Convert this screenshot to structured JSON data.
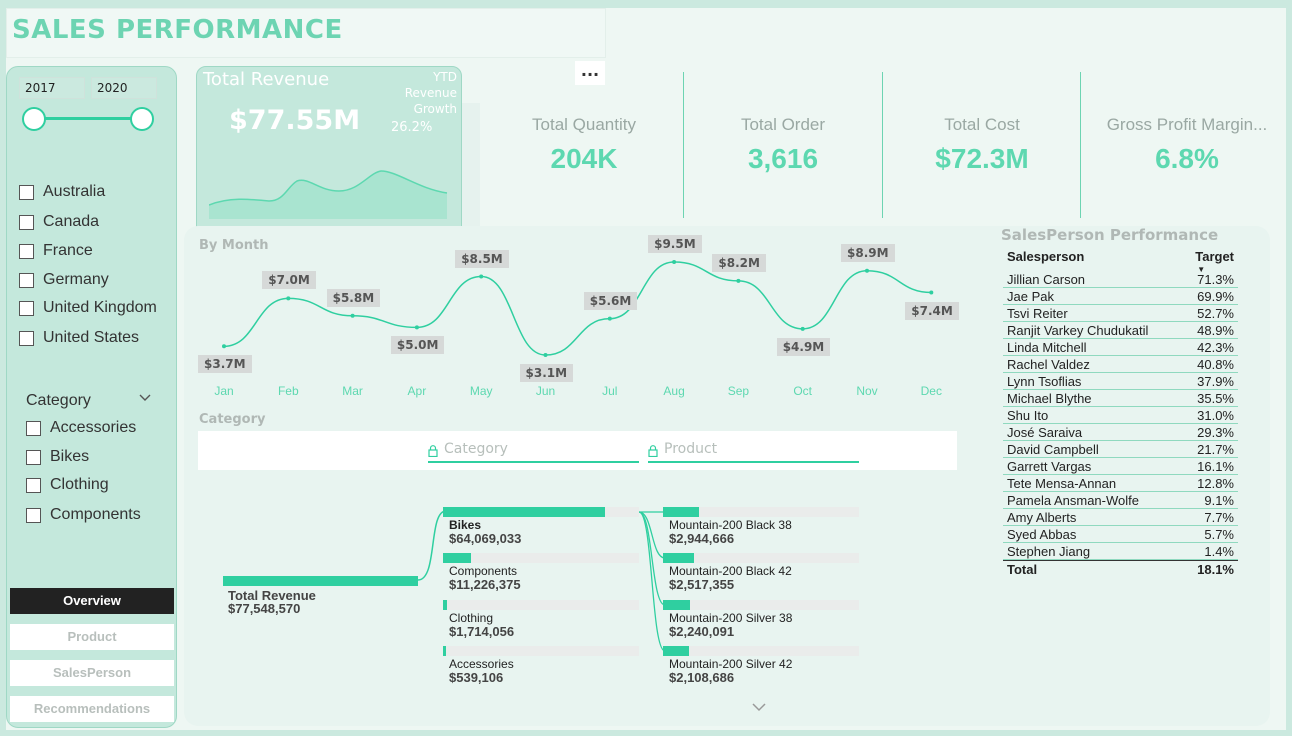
{
  "header": {
    "title": "SALES PERFORMANCE"
  },
  "slicer": {
    "year_start": "2017",
    "year_end": "2020"
  },
  "countries": [
    "Australia",
    "Canada",
    "France",
    "Germany",
    "United Kingdom",
    "United States"
  ],
  "category_slicer": {
    "label": "Category",
    "items": [
      "Accessories",
      "Bikes",
      "Clothing",
      "Components"
    ]
  },
  "nav": {
    "overview": "Overview",
    "product": "Product",
    "salesperson": "SalesPerson",
    "recommendations": "Recommendations"
  },
  "revenue_card": {
    "title": "Total Revenue",
    "value": "$77.55M",
    "ytd_label_1": "YTD",
    "ytd_label_2": "Revenue",
    "ytd_label_3": "Growth",
    "ytd_value": "26.2%"
  },
  "kpis": [
    {
      "label": "Total Quantity",
      "value": "204K"
    },
    {
      "label": "Total Order",
      "value": "3,616"
    },
    {
      "label": "Total Cost",
      "value": "$72.3M"
    },
    {
      "label": "Gross Profit Margin...",
      "value": "6.8%"
    }
  ],
  "more_options": "...",
  "by_month": {
    "label": "By Month"
  },
  "chart_data": {
    "type": "line",
    "categories": [
      "Jan",
      "Feb",
      "Mar",
      "Apr",
      "May",
      "Jun",
      "Jul",
      "Aug",
      "Sep",
      "Oct",
      "Nov",
      "Dec"
    ],
    "values": [
      3.7,
      7.0,
      5.8,
      5.0,
      8.5,
      3.1,
      5.6,
      9.5,
      8.2,
      4.9,
      8.9,
      7.4
    ],
    "labels": [
      "$3.7M",
      "$7.0M",
      "$5.8M",
      "$5.0M",
      "$8.5M",
      "$3.1M",
      "$5.6M",
      "$9.5M",
      "$8.2M",
      "$4.9M",
      "$8.9M",
      "$7.4M"
    ],
    "color": "#2fcfa0",
    "grid": false
  },
  "category_section": {
    "label": "Category",
    "filter_category": "Category",
    "filter_product": "Product",
    "root": {
      "name": "Total Revenue",
      "value": "$77,548,570"
    },
    "categories": [
      {
        "name": "Bikes",
        "value": "$64,069,033",
        "fraction": 0.826
      },
      {
        "name": "Components",
        "value": "$11,226,375",
        "fraction": 0.145
      },
      {
        "name": "Clothing",
        "value": "$1,714,056",
        "fraction": 0.022
      },
      {
        "name": "Accessories",
        "value": "$539,106",
        "fraction": 0.007
      }
    ],
    "products": [
      {
        "name": "Mountain-200 Black 38",
        "value": "$2,944,666",
        "fraction": 0.046
      },
      {
        "name": "Mountain-200 Black 42",
        "value": "$2,517,355",
        "fraction": 0.039
      },
      {
        "name": "Mountain-200 Silver 38",
        "value": "$2,240,091",
        "fraction": 0.035
      },
      {
        "name": "Mountain-200 Silver 42",
        "value": "$2,108,686",
        "fraction": 0.033
      }
    ]
  },
  "salesperson": {
    "title": "SalesPerson Performance",
    "col_name": "Salesperson",
    "col_target": "Target",
    "rows": [
      {
        "name": "Jillian Carson",
        "target": "71.3%"
      },
      {
        "name": "Jae Pak",
        "target": "69.9%"
      },
      {
        "name": "Tsvi Reiter",
        "target": "52.7%"
      },
      {
        "name": "Ranjit Varkey Chudukatil",
        "target": "48.9%"
      },
      {
        "name": "Linda Mitchell",
        "target": "42.3%"
      },
      {
        "name": "Rachel Valdez",
        "target": "40.8%"
      },
      {
        "name": "Lynn Tsoflias",
        "target": "37.9%"
      },
      {
        "name": "Michael Blythe",
        "target": "35.5%"
      },
      {
        "name": "Shu Ito",
        "target": "31.0%"
      },
      {
        "name": "José Saraiva",
        "target": "29.3%"
      },
      {
        "name": "David Campbell",
        "target": "21.7%"
      },
      {
        "name": "Garrett Vargas",
        "target": "16.1%"
      },
      {
        "name": "Tete Mensa-Annan",
        "target": "12.8%"
      },
      {
        "name": "Pamela Ansman-Wolfe",
        "target": "9.1%"
      },
      {
        "name": "Amy Alberts",
        "target": "7.7%"
      },
      {
        "name": "Syed Abbas",
        "target": "5.7%"
      },
      {
        "name": "Stephen Jiang",
        "target": "1.4%"
      }
    ],
    "total_label": "Total",
    "total_value": "18.1%"
  }
}
